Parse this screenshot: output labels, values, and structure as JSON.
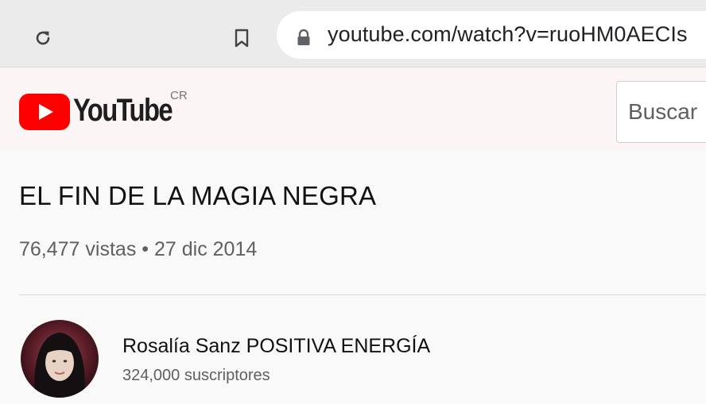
{
  "browser": {
    "url": "youtube.com/watch?v=ruoHM0AECIs"
  },
  "header": {
    "logo_text": "YouTube",
    "country_code": "CR",
    "search_placeholder": "Buscar"
  },
  "video": {
    "title": "EL FIN DE LA MAGIA NEGRA",
    "views": "76,477 vistas",
    "separator": "•",
    "date": "27 dic 2014"
  },
  "channel": {
    "name": "Rosalía Sanz POSITIVA ENERGÍA",
    "subscribers": "324,000 suscriptores"
  },
  "colors": {
    "youtube_red": "#ff0000",
    "text_primary": "#111111",
    "text_secondary": "#606060"
  }
}
